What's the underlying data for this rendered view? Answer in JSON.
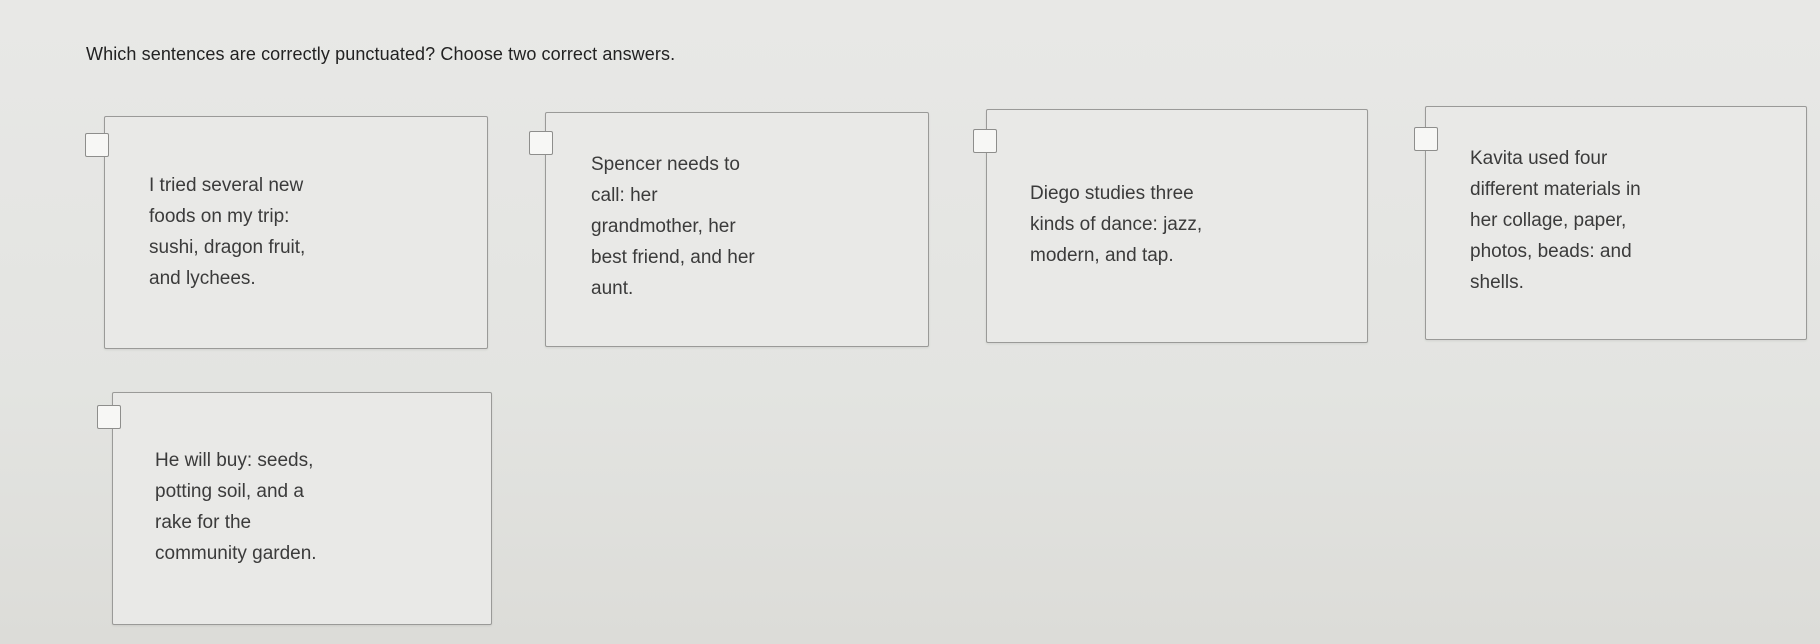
{
  "question": "Which sentences are correctly punctuated? Choose two correct answers.",
  "options": [
    {
      "lines": [
        "I tried several new",
        "foods on my trip:",
        "sushi, dragon fruit,",
        "and lychees."
      ]
    },
    {
      "lines": [
        "Spencer needs to",
        "call: her",
        "grandmother, her",
        "best friend, and her",
        "aunt."
      ]
    },
    {
      "lines": [
        "Diego studies three",
        "kinds of dance: jazz,",
        "modern, and tap."
      ]
    },
    {
      "lines": [
        "Kavita used four",
        "different materials in",
        "her collage, paper,",
        "photos, beads: and",
        "shells."
      ]
    },
    {
      "lines": [
        "He will buy: seeds,",
        "potting soil, and a",
        "rake for the",
        "community garden."
      ]
    }
  ]
}
